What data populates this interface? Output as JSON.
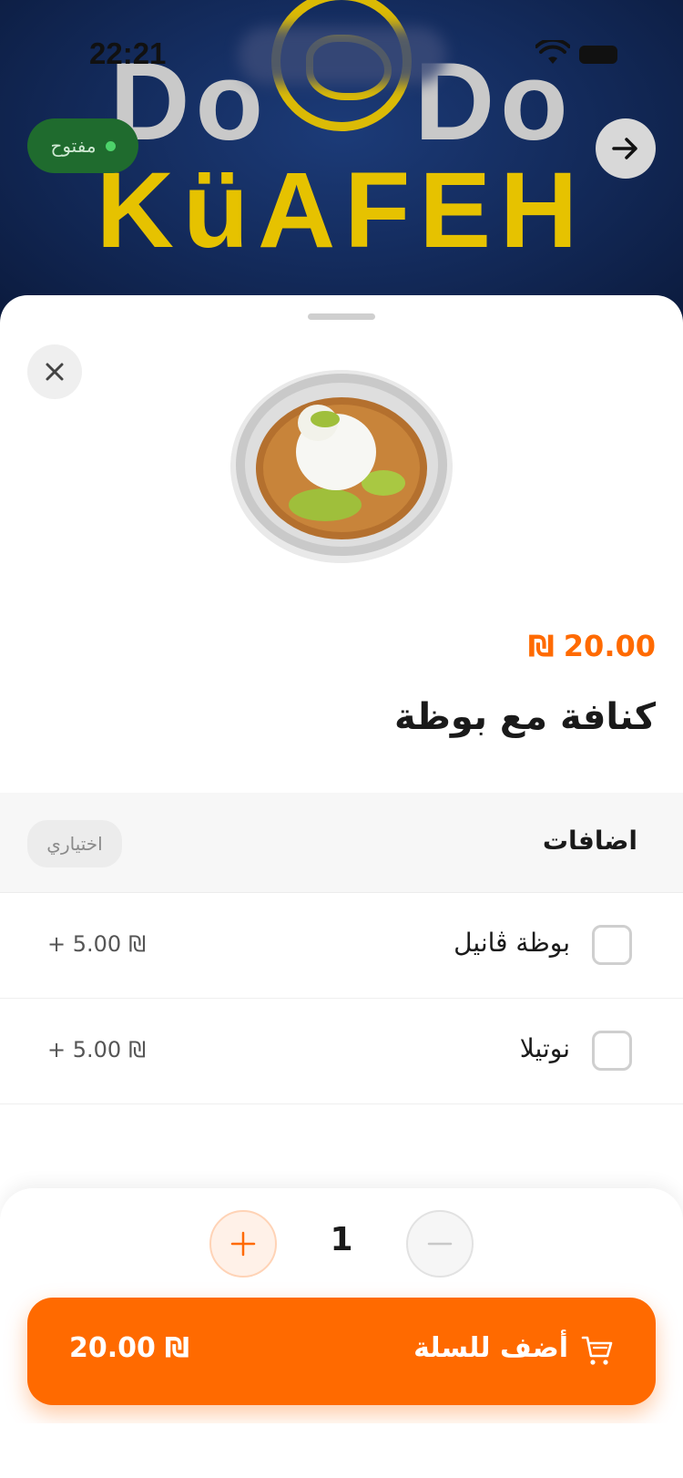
{
  "status_bar": {
    "time": "22:21"
  },
  "banner": {
    "brand_line1_left": "Do",
    "brand_line1_right": "Do",
    "brand_line2": "KüAFEH",
    "open_status": "مفتوح"
  },
  "product": {
    "price": "20.00",
    "currency": "₪",
    "title": "كنافة مع بوظة"
  },
  "addons": {
    "title": "اضافات",
    "optional_label": "اختياري",
    "items": [
      {
        "label": "بوظة ڤانيل",
        "price": "+ 5.00",
        "currency": "₪"
      },
      {
        "label": "نوتيلا",
        "price": "+ 5.00",
        "currency": "₪"
      }
    ]
  },
  "quantity": {
    "value": "1"
  },
  "cart_button": {
    "label": "أضف للسلة",
    "total": "20.00",
    "currency": "₪"
  },
  "colors": {
    "accent": "#ff6a00",
    "open_badge": "#1f6b2e",
    "banner": "#142c5e"
  },
  "icons": [
    "wifi-icon",
    "battery-icon",
    "arrow-right-icon",
    "close-icon",
    "plus-icon",
    "minus-icon",
    "cart-icon"
  ]
}
